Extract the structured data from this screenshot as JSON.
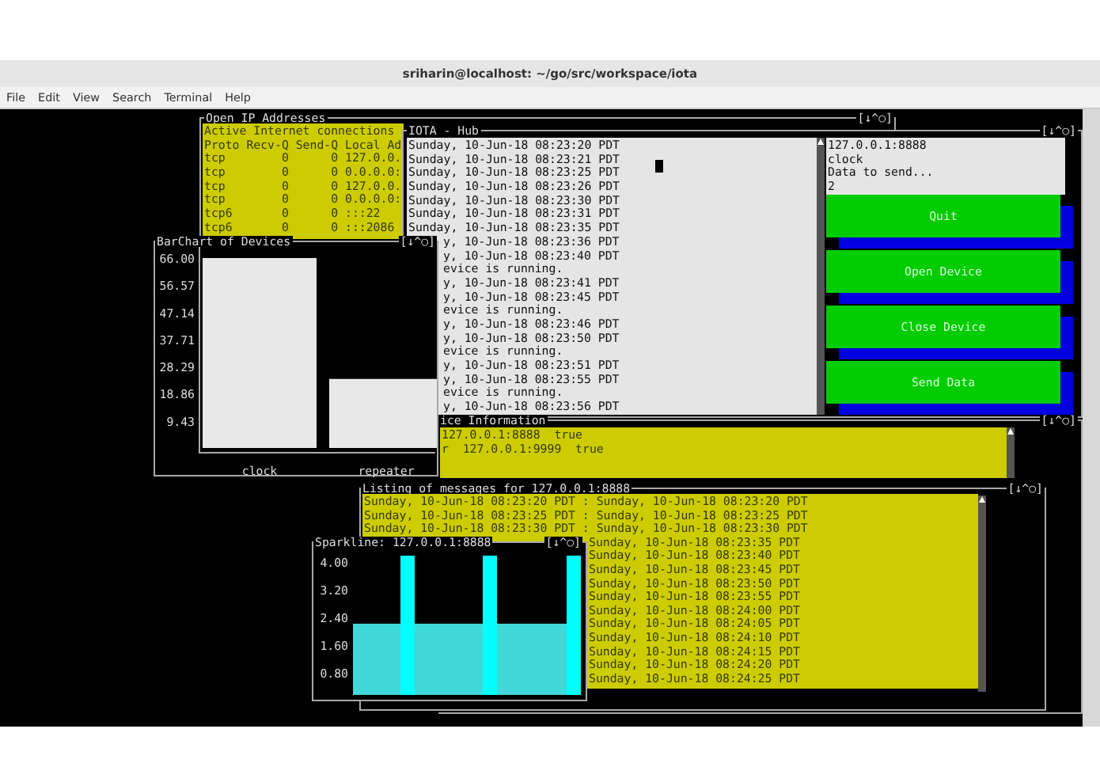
{
  "window": {
    "title": "sriharin@localhost: ~/go/src/workspace/iota"
  },
  "menu": [
    "File",
    "Edit",
    "View",
    "Search",
    "Terminal",
    "Help"
  ],
  "ip_panel": {
    "title": "Open IP Addresses",
    "window_controls": "[↓^○]",
    "lines": [
      "Active Internet connections",
      "Proto Recv-Q Send-Q Local Ad",
      "tcp        0      0 127.0.0.",
      "tcp        0      0 0.0.0.0:",
      "tcp        0      0 127.0.0.",
      "tcp        0      0 0.0.0.0:",
      "tcp6       0      0 :::22",
      "tcp6       0      0 :::2086"
    ]
  },
  "hub": {
    "title": "IOTA - Hub",
    "window_controls": "[↓^○]",
    "lines": [
      {
        "kind": "full",
        "text": "Sunday, 10-Jun-18 08:23:20 PDT"
      },
      {
        "kind": "full",
        "text": "Sunday, 10-Jun-18 08:23:21 PDT"
      },
      {
        "kind": "full",
        "text": "Sunday, 10-Jun-18 08:23:25 PDT"
      },
      {
        "kind": "full",
        "text": "Sunday, 10-Jun-18 08:23:26 PDT"
      },
      {
        "kind": "full",
        "text": "Sunday, 10-Jun-18 08:23:30 PDT"
      },
      {
        "kind": "full",
        "text": "Sunday, 10-Jun-18 08:23:31 PDT"
      },
      {
        "kind": "full",
        "text": "Sunday, 10-Jun-18 08:23:35 PDT"
      },
      {
        "kind": "clipped",
        "text": "y, 10-Jun-18 08:23:36 PDT"
      },
      {
        "kind": "clipped",
        "text": "y, 10-Jun-18 08:23:40 PDT"
      },
      {
        "kind": "clipped",
        "text": "evice is running."
      },
      {
        "kind": "clipped",
        "text": "y, 10-Jun-18 08:23:41 PDT"
      },
      {
        "kind": "clipped",
        "text": "y, 10-Jun-18 08:23:45 PDT"
      },
      {
        "kind": "clipped",
        "text": "evice is running."
      },
      {
        "kind": "clipped",
        "text": "y, 10-Jun-18 08:23:46 PDT"
      },
      {
        "kind": "clipped",
        "text": "y, 10-Jun-18 08:23:50 PDT"
      },
      {
        "kind": "clipped",
        "text": "evice is running."
      },
      {
        "kind": "clipped",
        "text": "y, 10-Jun-18 08:23:51 PDT"
      },
      {
        "kind": "clipped",
        "text": "y, 10-Jun-18 08:23:55 PDT"
      },
      {
        "kind": "clipped",
        "text": "evice is running."
      },
      {
        "kind": "clipped",
        "text": "y, 10-Jun-18 08:23:56 PDT"
      }
    ],
    "info_lines": [
      "127.0.0.1:8888",
      "clock",
      "Data to send...",
      "2"
    ],
    "buttons": [
      "Quit",
      "Open Device",
      "Close Device",
      "Send Data"
    ]
  },
  "bar_chart": {
    "title": "BarChart of Devices",
    "window_controls": "[↓^○]",
    "chart_data": {
      "type": "bar",
      "categories": [
        "clock",
        "repeater"
      ],
      "values": [
        66,
        24
      ],
      "ylim": [
        0,
        66
      ],
      "yticks": [
        {
          "value": 9.43,
          "label": "9.43"
        },
        {
          "value": 18.86,
          "label": "18.86"
        },
        {
          "value": 28.29,
          "label": "28.29"
        },
        {
          "value": 37.71,
          "label": "37.71"
        },
        {
          "value": 47.14,
          "label": "47.14"
        },
        {
          "value": 56.57,
          "label": "56.57"
        },
        {
          "value": 66,
          "label": "66.00"
        }
      ]
    }
  },
  "device_info": {
    "title": "ice Information",
    "window_controls": "[↓^○]",
    "lines": [
      "127.0.0.1:8888  true",
      "r  127.0.0.1:9999  true"
    ]
  },
  "listing": {
    "title": "Listing of messages for 127.0.0.1:8888",
    "window_controls": "[↓^○]",
    "lines": [
      {
        "kind": "full",
        "text": "Sunday, 10-Jun-18 08:23:20 PDT : Sunday, 10-Jun-18 08:23:20 PDT"
      },
      {
        "kind": "full",
        "text": "Sunday, 10-Jun-18 08:23:25 PDT : Sunday, 10-Jun-18 08:23:25 PDT"
      },
      {
        "kind": "full",
        "text": "Sunday, 10-Jun-18 08:23:30 PDT : Sunday, 10-Jun-18 08:23:30 PDT"
      },
      {
        "kind": "clipped",
        "text": "Sunday, 10-Jun-18 08:23:35 PDT"
      },
      {
        "kind": "clipped",
        "text": "Sunday, 10-Jun-18 08:23:40 PDT"
      },
      {
        "kind": "clipped",
        "text": "Sunday, 10-Jun-18 08:23:45 PDT"
      },
      {
        "kind": "clipped",
        "text": "Sunday, 10-Jun-18 08:23:50 PDT"
      },
      {
        "kind": "clipped",
        "text": "Sunday, 10-Jun-18 08:23:55 PDT"
      },
      {
        "kind": "clipped",
        "text": "Sunday, 10-Jun-18 08:24:00 PDT"
      },
      {
        "kind": "clipped",
        "text": "Sunday, 10-Jun-18 08:24:05 PDT"
      },
      {
        "kind": "clipped",
        "text": "Sunday, 10-Jun-18 08:24:10 PDT"
      },
      {
        "kind": "clipped",
        "text": "Sunday, 10-Jun-18 08:24:15 PDT"
      },
      {
        "kind": "clipped",
        "text": "Sunday, 10-Jun-18 08:24:20 PDT"
      },
      {
        "kind": "clipped",
        "text": "Sunday, 10-Jun-18 08:24:25 PDT"
      }
    ]
  },
  "sparkline": {
    "title": "Sparkline: 127.0.0.1:8888",
    "window_controls": "[↓^○]",
    "y_labels": [
      "4.00",
      "3.20",
      "2.40",
      "1.60",
      "0.80"
    ]
  }
}
